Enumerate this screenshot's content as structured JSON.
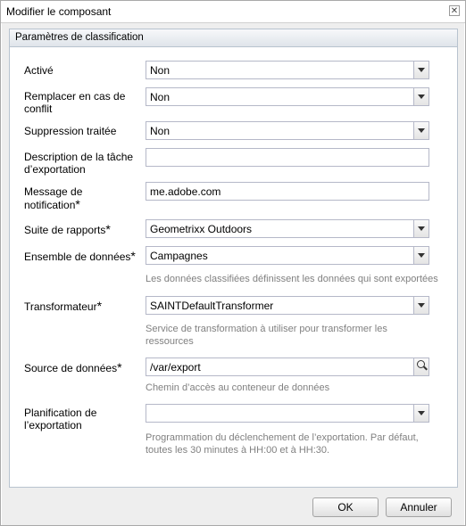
{
  "dialog": {
    "title": "Modifier le composant",
    "close_icon": "close-icon",
    "panel_title": "Paramètres de classification"
  },
  "fields": {
    "active": {
      "label": "Activé",
      "value": "Non"
    },
    "replace": {
      "label_line1": "Remplacer en cas de",
      "label_line2": "conflit",
      "value": "Non"
    },
    "deletion": {
      "label": "Suppression traitée",
      "value": "Non"
    },
    "description": {
      "label_line1": "Description de la tâche",
      "label_line2": "d’exportation",
      "value": ""
    },
    "notification": {
      "label_line1": "Message de",
      "label_line2": "notification",
      "required": "*",
      "value": "me.adobe.com"
    },
    "report_suite": {
      "label": "Suite de rapports",
      "required": "*",
      "value": "Geometrixx Outdoors"
    },
    "dataset": {
      "label": "Ensemble de données",
      "required": "*",
      "value": "Campagnes",
      "help": "Les données classifiées définissent les données qui sont exportées"
    },
    "transformer": {
      "label": "Transformateur",
      "required": "*",
      "value": "SAINTDefaultTransformer",
      "help_line1": "Service de transformation à utiliser pour transformer les",
      "help_line2": "ressources"
    },
    "datasource": {
      "label": "Source de données",
      "required": "*",
      "value": "/var/export",
      "help": "Chemin d’accès au conteneur de données",
      "icon": "search-icon"
    },
    "schedule": {
      "label_line1": "Planification de",
      "label_line2": "l’exportation",
      "value": "",
      "help_line1": "Programmation du déclenchement de l’exportation. Par défaut,",
      "help_line2": "toutes les 30 minutes à HH:00 et à HH:30."
    }
  },
  "footer": {
    "ok_label": "OK",
    "cancel_label": "Annuler"
  }
}
